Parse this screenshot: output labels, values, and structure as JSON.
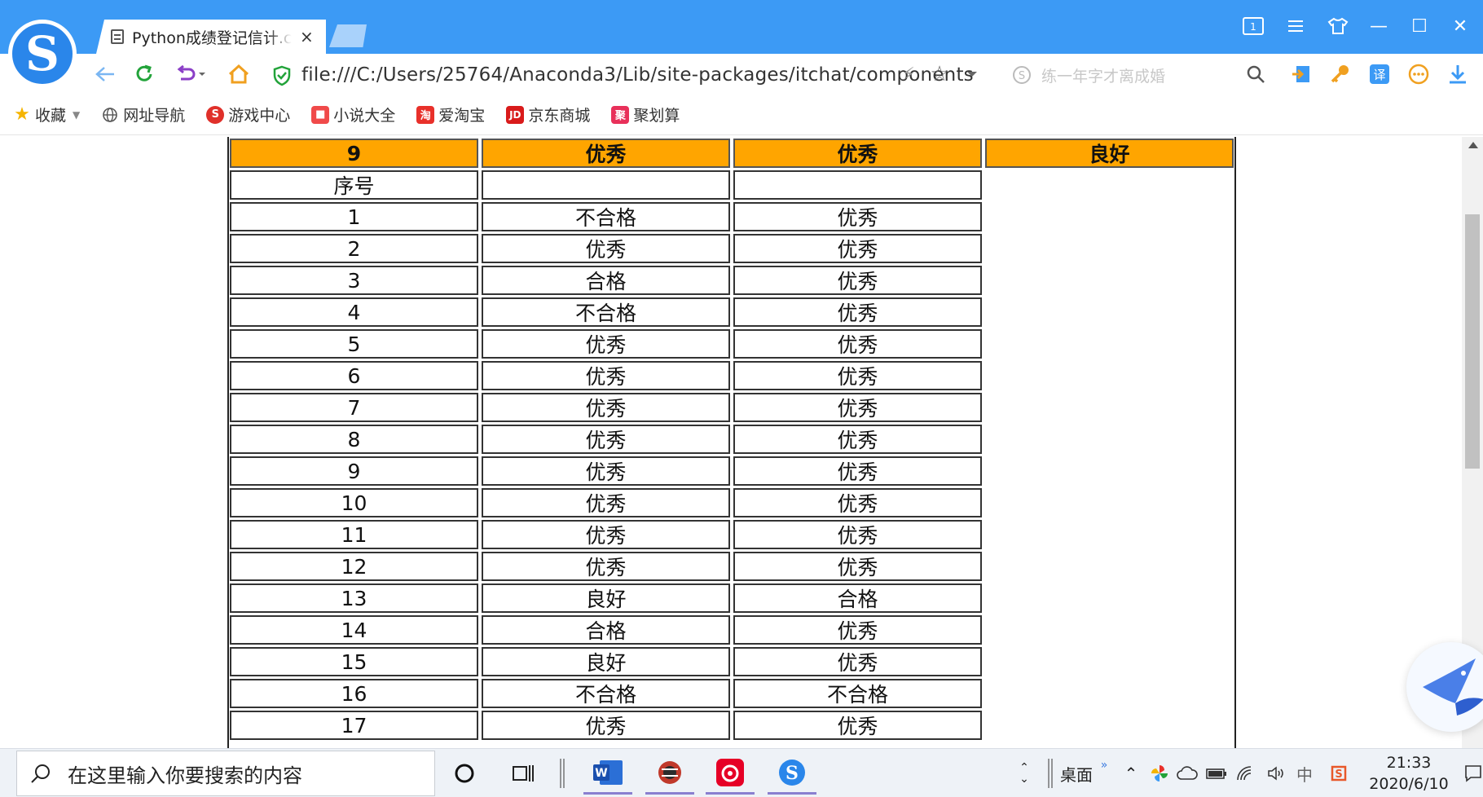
{
  "browser": {
    "tab_title": "Python成绩登记信计.csv",
    "tab_close": "×",
    "url": "file:///C:/Users/25764/Anaconda3/Lib/site-packages/itchat/components",
    "search_placeholder": "练一年字才离成婚",
    "window_badge": "1",
    "minimize": "—",
    "maximize": "☐",
    "close": "✕"
  },
  "bookmarks": [
    {
      "label": "收藏",
      "icon": "star-icon"
    },
    {
      "label": "网址导航",
      "icon": "globe-icon"
    },
    {
      "label": "游戏中心",
      "icon": "game-icon"
    },
    {
      "label": "小说大全",
      "icon": "book-icon"
    },
    {
      "label": "爱淘宝",
      "icon": "taobao-icon"
    },
    {
      "label": "京东商城",
      "icon": "jd-icon"
    },
    {
      "label": "聚划算",
      "icon": "juhuasuan-icon"
    }
  ],
  "table": {
    "header": [
      "9",
      "优秀",
      "优秀",
      "良好"
    ],
    "label_row": [
      "序号",
      "",
      ""
    ],
    "rows": [
      [
        "1",
        "不合格",
        "优秀"
      ],
      [
        "2",
        "优秀",
        "优秀"
      ],
      [
        "3",
        "合格",
        "优秀"
      ],
      [
        "4",
        "不合格",
        "优秀"
      ],
      [
        "5",
        "优秀",
        "优秀"
      ],
      [
        "6",
        "优秀",
        "优秀"
      ],
      [
        "7",
        "优秀",
        "优秀"
      ],
      [
        "8",
        "优秀",
        "优秀"
      ],
      [
        "9",
        "优秀",
        "优秀"
      ],
      [
        "10",
        "优秀",
        "优秀"
      ],
      [
        "11",
        "优秀",
        "优秀"
      ],
      [
        "12",
        "优秀",
        "优秀"
      ],
      [
        "13",
        "良好",
        "合格"
      ],
      [
        "14",
        "合格",
        "优秀"
      ],
      [
        "15",
        "良好",
        "优秀"
      ],
      [
        "16",
        "不合格",
        "不合格"
      ],
      [
        "17",
        "优秀",
        "优秀"
      ]
    ]
  },
  "taskbar": {
    "search_placeholder": "在这里输入你要搜索的内容",
    "desktop_label": "桌面",
    "ime": "中",
    "time": "21:33",
    "date": "2020/6/10"
  },
  "colors": {
    "titlebar": "#3c9af5",
    "header_fill": "#ffa500"
  }
}
